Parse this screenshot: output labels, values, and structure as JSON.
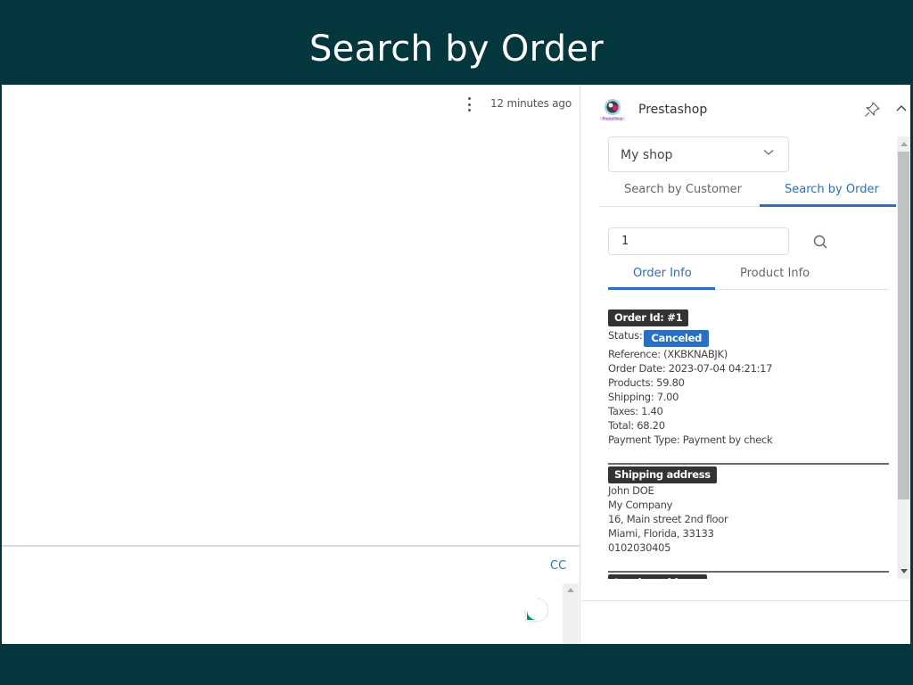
{
  "banner": {
    "title": "Search by Order"
  },
  "email": {
    "timestamp": "12 minutes ago",
    "cc_label": "CC"
  },
  "addin": {
    "name": "Prestashop",
    "logo_text": "PrestaShop",
    "shop_select": {
      "value": "My shop"
    },
    "main_tabs": [
      {
        "label": "Search by Customer",
        "active": false
      },
      {
        "label": "Search by Order",
        "active": true
      }
    ],
    "search": {
      "value": "1",
      "placeholder": ""
    },
    "sub_tabs": [
      {
        "label": "Order Info",
        "active": true
      },
      {
        "label": "Product Info",
        "active": false
      }
    ],
    "order": {
      "id_label": "Order Id: #1",
      "status_label": "Status:",
      "status_value": "Canceled",
      "status_color": "#2a6fc0",
      "fields": [
        "Reference: (XKBKNABJK)",
        "Order Date: 2023-07-04 04:21:17",
        "Products: 59.80",
        "Shipping: 7.00",
        "Taxes: 1.40",
        "Total: 68.20",
        "Payment Type: Payment by check"
      ]
    },
    "shipping_address": {
      "title": "Shipping address",
      "lines": [
        "John DOE",
        "My Company",
        "16, Main street 2nd floor",
        "Miami, Florida, 33133",
        "0102030405"
      ]
    },
    "invoice_address": {
      "title": "Invoice address"
    }
  },
  "colors": {
    "banner_bg": "#04363e",
    "accent": "#2a6fc0",
    "tag_bg": "#333333"
  }
}
